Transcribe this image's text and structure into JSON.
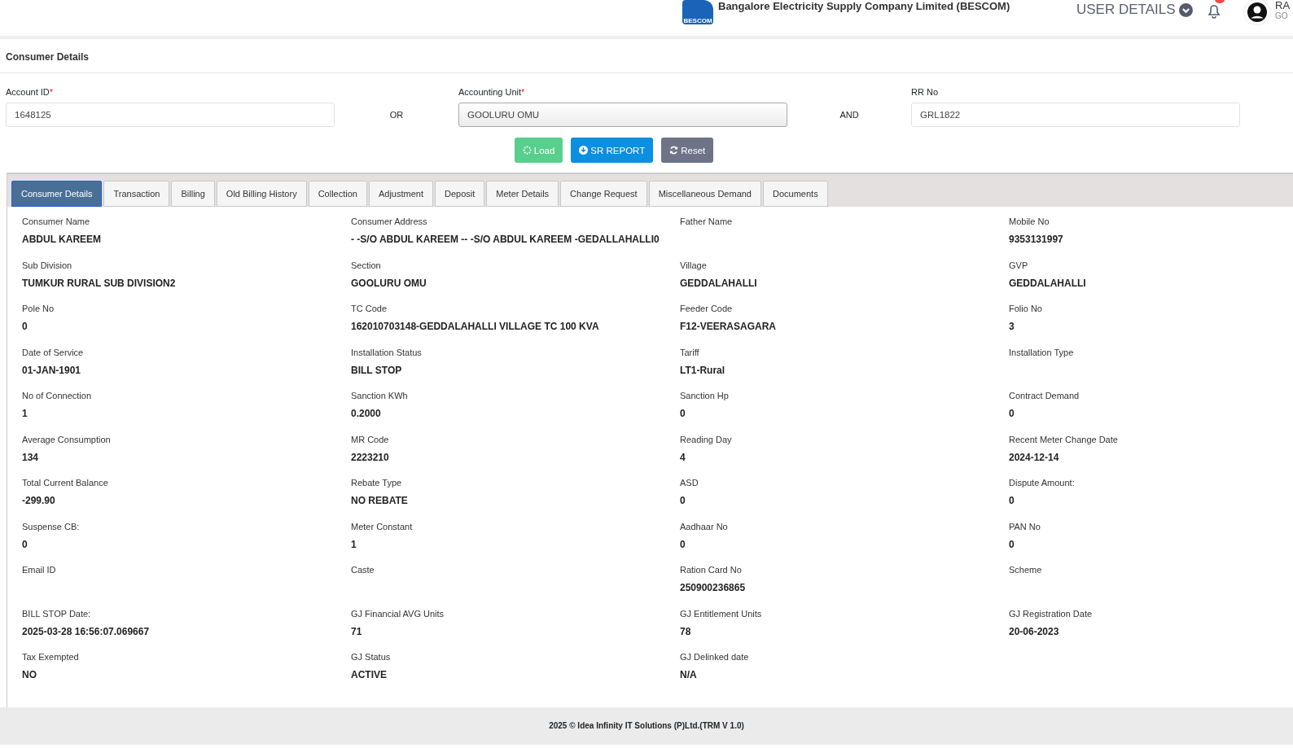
{
  "header": {
    "logo_text": "BESCOM",
    "title": "Bangalore Electricity Supply Company Limited (BESCOM)",
    "user_menu": "USER DETAILS",
    "user_name": "RA",
    "user_sub": "GO"
  },
  "page_title": "Consumer Details",
  "form": {
    "fields": [
      {
        "label": "Account ID",
        "required_mark": "*",
        "value": "1648125",
        "kind": "input"
      },
      {
        "joiner": "OR"
      },
      {
        "label": "Accounting Unit",
        "required_mark": "*",
        "value": "GOOLURU OMU",
        "kind": "select"
      },
      {
        "joiner": "AND"
      },
      {
        "label": "RR No",
        "value": "GRL1822",
        "kind": "input"
      }
    ],
    "buttons": [
      {
        "label": "Load",
        "kind": "load"
      },
      {
        "label": "SR REPORT",
        "kind": "report"
      },
      {
        "label": "Reset",
        "kind": "reset"
      }
    ]
  },
  "tabs": [
    {
      "label": "Consumer Details",
      "selected": true
    },
    {
      "label": "Transaction",
      "selected": false
    },
    {
      "label": "Billing",
      "selected": false
    },
    {
      "label": "Old Billing History",
      "selected": false
    },
    {
      "label": "Collection",
      "selected": false
    },
    {
      "label": "Adjustment",
      "selected": false
    },
    {
      "label": "Deposit",
      "selected": false
    },
    {
      "label": "Meter Details",
      "selected": false
    },
    {
      "label": "Change Request",
      "selected": false
    },
    {
      "label": "Miscellaneous Demand",
      "selected": false
    },
    {
      "label": "Documents",
      "selected": false
    }
  ],
  "details": [
    {
      "label": "Consumer Name",
      "value": "ABDUL KAREEM"
    },
    {
      "label": "Consumer Address",
      "value": "- -S/O ABDUL KAREEM -- -S/O ABDUL KAREEM -GEDALLAHALLI0"
    },
    {
      "label": "Father Name"
    },
    {
      "label": "Mobile No",
      "value": "9353131997"
    },
    {
      "label": "Sub Division",
      "value": "TUMKUR RURAL SUB DIVISION2"
    },
    {
      "label": "Section",
      "value": "GOOLURU OMU"
    },
    {
      "label": "Village",
      "value": "GEDDALAHALLI"
    },
    {
      "label": "GVP",
      "value": "GEDDALAHALLI"
    },
    {
      "label": "Pole No",
      "value": "0"
    },
    {
      "label": "TC Code",
      "value": "162010703148-GEDDALAHALLI VILLAGE TC 100 KVA"
    },
    {
      "label": "Feeder Code",
      "value": "F12-VEERASAGARA"
    },
    {
      "label": "Folio No",
      "value": "3"
    },
    {
      "label": "Date of Service",
      "value": "01-JAN-1901"
    },
    {
      "label": "Installation Status",
      "value": "BILL STOP"
    },
    {
      "label": "Tariff",
      "value": "LT1-Rural"
    },
    {
      "label": "Installation Type"
    },
    {
      "label": "No of Connection",
      "value": "1"
    },
    {
      "label": "Sanction KWh",
      "value": "0.2000"
    },
    {
      "label": "Sanction Hp",
      "value": "0"
    },
    {
      "label": "Contract Demand",
      "value": "0"
    },
    {
      "label": "Average Consumption",
      "value": "134"
    },
    {
      "label": "MR Code",
      "value": "2223210"
    },
    {
      "label": "Reading Day",
      "value": "4"
    },
    {
      "label": "Recent Meter Change Date",
      "value": "2024-12-14"
    },
    {
      "label": "Total Current Balance",
      "value": "-299.90"
    },
    {
      "label": "Rebate Type",
      "value": "NO REBATE"
    },
    {
      "label": "ASD",
      "value": "0"
    },
    {
      "label": "Dispute Amount:",
      "value": "0"
    },
    {
      "label": "Suspense CB:",
      "value": "0"
    },
    {
      "label": "Meter Constant",
      "value": "1"
    },
    {
      "label": "Aadhaar No",
      "value": "0"
    },
    {
      "label": "PAN No",
      "value": "0"
    },
    {
      "label": "Email ID"
    },
    {
      "label": "Caste"
    },
    {
      "label": "Ration Card No",
      "value": "250900236865"
    },
    {
      "label": "Scheme"
    },
    {
      "label": "BILL STOP Date:",
      "value": "2025-03-28 16:56:07.069667"
    },
    {
      "label": "GJ Financial AVG Units",
      "value": "71"
    },
    {
      "label": "GJ Entitlement Units",
      "value": "78"
    },
    {
      "label": "GJ Registration Date",
      "value": "20-06-2023"
    },
    {
      "label": "Tax Exempted",
      "value": "NO"
    },
    {
      "label": "GJ Status",
      "value": "ACTIVE"
    },
    {
      "label": "GJ Delinked date",
      "value": "N/A"
    }
  ],
  "footer": "2025 © Idea Infinity IT Solutions (P)Ltd.(TRM V 1.0)"
}
